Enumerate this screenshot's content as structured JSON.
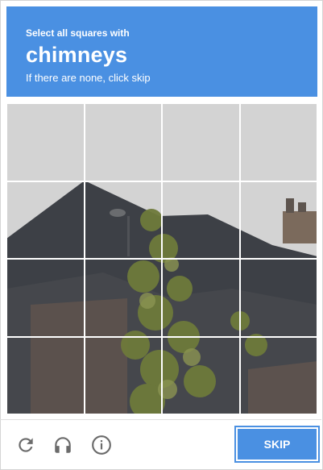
{
  "header": {
    "instruction": "Select all squares with",
    "target": "chimneys",
    "subtext": "If there are none, click skip"
  },
  "grid": {
    "rows": 4,
    "cols": 4
  },
  "footer": {
    "icons": [
      "reload-icon",
      "audio-icon",
      "info-icon"
    ],
    "skip_label": "SKIP"
  },
  "colors": {
    "accent": "#4a90e2",
    "sky": "#d2d2d2",
    "roof": "#3b3e44",
    "brick": "#5a4f4b",
    "foliage": "#6f7a3c"
  }
}
